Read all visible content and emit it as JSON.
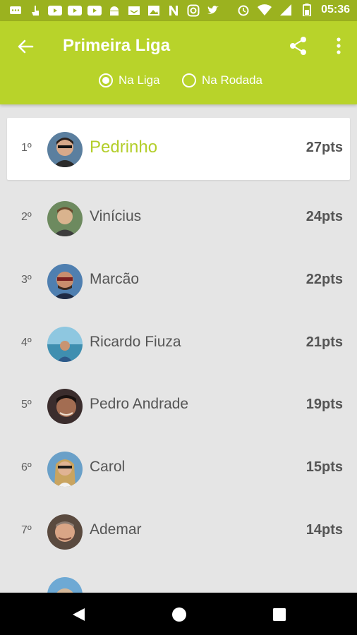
{
  "status_bar": {
    "time": "05:36",
    "left_icons": [
      "chat-icon",
      "hand-icon",
      "youtube-icon",
      "youtube-icon",
      "youtube-icon",
      "android-icon",
      "inbox-icon",
      "image-icon",
      "n-icon",
      "instagram-icon",
      "twitter-icon"
    ],
    "right_icons": [
      "alarm-icon",
      "wifi-icon",
      "signal-icon",
      "battery-icon"
    ]
  },
  "app_bar": {
    "title": "Primeira Liga",
    "filters": [
      {
        "label": "Na Liga",
        "selected": true
      },
      {
        "label": "Na Rodada",
        "selected": false
      }
    ]
  },
  "ranking": [
    {
      "rank": "1º",
      "name": "Pedrinho",
      "points": "27pts",
      "highlight": true,
      "avatar_color": "#5b7f9f"
    },
    {
      "rank": "2º",
      "name": "Vinícius",
      "points": "24pts",
      "highlight": false,
      "avatar_color": "#6d8a5f"
    },
    {
      "rank": "3º",
      "name": "Marcão",
      "points": "22pts",
      "highlight": false,
      "avatar_color": "#4f7fb0"
    },
    {
      "rank": "4º",
      "name": "Ricardo Fiuza",
      "points": "21pts",
      "highlight": false,
      "avatar_color": "#7cb3c7"
    },
    {
      "rank": "5º",
      "name": "Pedro Andrade",
      "points": "19pts",
      "highlight": false,
      "avatar_color": "#3b2d2d"
    },
    {
      "rank": "6º",
      "name": "Carol",
      "points": "15pts",
      "highlight": false,
      "avatar_color": "#6aa0c8"
    },
    {
      "rank": "7º",
      "name": "Ademar",
      "points": "14pts",
      "highlight": false,
      "avatar_color": "#5a4a3f"
    },
    {
      "rank": "",
      "name": "",
      "points": "",
      "highlight": false,
      "avatar_color": "#6ea9d4"
    }
  ],
  "colors": {
    "app_bar": "#b8d32a",
    "status_bar": "#9bb21f",
    "highlight_text": "#b3ce2a",
    "background": "#e5e5e5"
  }
}
